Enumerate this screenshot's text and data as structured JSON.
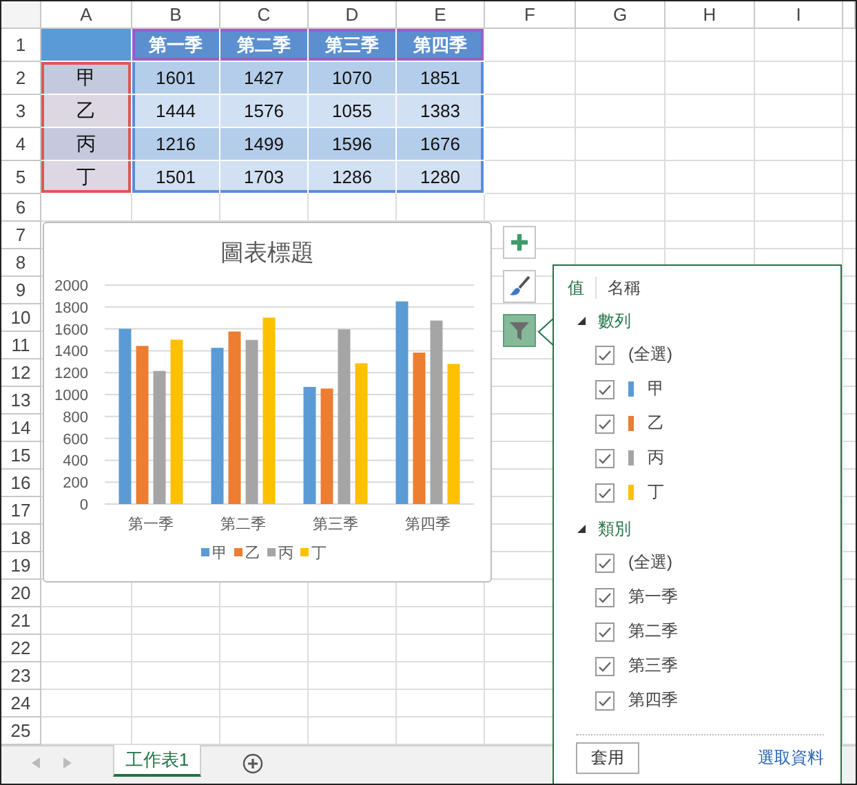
{
  "sheet": {
    "column_headers": [
      "A",
      "B",
      "C",
      "D",
      "E",
      "F",
      "G",
      "H",
      "I"
    ],
    "row_numbers": [
      "1",
      "2",
      "3",
      "4",
      "5",
      "6",
      "7",
      "8",
      "9",
      "10",
      "11",
      "12",
      "13",
      "14",
      "15",
      "16",
      "17",
      "18",
      "19",
      "20",
      "21",
      "22",
      "23",
      "24",
      "25"
    ],
    "table": {
      "header": [
        "第一季",
        "第二季",
        "第三季",
        "第四季"
      ],
      "rows": [
        {
          "label": "甲",
          "values": [
            "1601",
            "1427",
            "1070",
            "1851"
          ]
        },
        {
          "label": "乙",
          "values": [
            "1444",
            "1576",
            "1055",
            "1383"
          ]
        },
        {
          "label": "丙",
          "values": [
            "1216",
            "1499",
            "1596",
            "1676"
          ]
        },
        {
          "label": "丁",
          "values": [
            "1501",
            "1703",
            "1286",
            "1280"
          ]
        }
      ]
    }
  },
  "chart": {
    "chart_data": {
      "type": "bar",
      "title": "圖表標題",
      "categories": [
        "第一季",
        "第二季",
        "第三季",
        "第四季"
      ],
      "series": [
        {
          "name": "甲",
          "color": "#5b9bd5",
          "values": [
            1601,
            1427,
            1070,
            1851
          ]
        },
        {
          "name": "乙",
          "color": "#ed7d31",
          "values": [
            1444,
            1576,
            1055,
            1383
          ]
        },
        {
          "name": "丙",
          "color": "#a5a5a5",
          "values": [
            1216,
            1499,
            1596,
            1676
          ]
        },
        {
          "name": "丁",
          "color": "#ffc000",
          "values": [
            1501,
            1703,
            1286,
            1280
          ]
        }
      ],
      "grid": true,
      "legend": "bottom",
      "ylim": [
        0,
        2000
      ],
      "yticks": [
        0,
        200,
        400,
        600,
        800,
        1000,
        1200,
        1400,
        1600,
        1800,
        2000
      ]
    }
  },
  "chart_buttons": [
    {
      "kind": "add",
      "selected": false
    },
    {
      "kind": "style",
      "selected": false
    },
    {
      "kind": "filter",
      "selected": true
    }
  ],
  "filter_panel": {
    "tabs": [
      {
        "label": "值",
        "selected": true
      },
      {
        "label": "名稱",
        "selected": false
      }
    ],
    "sections": [
      {
        "label": "數列",
        "expanded": true,
        "items": [
          {
            "label": "(全選)",
            "checked": true
          },
          {
            "label": "甲",
            "checked": true,
            "color": "#5b9bd5"
          },
          {
            "label": "乙",
            "checked": true,
            "color": "#ed7d31"
          },
          {
            "label": "丙",
            "checked": true,
            "color": "#a5a5a5"
          },
          {
            "label": "丁",
            "checked": true,
            "color": "#ffc000"
          }
        ]
      },
      {
        "label": "類別",
        "expanded": true,
        "items": [
          {
            "label": "(全選)",
            "checked": true
          },
          {
            "label": "第一季",
            "checked": true
          },
          {
            "label": "第二季",
            "checked": true
          },
          {
            "label": "第三季",
            "checked": true
          },
          {
            "label": "第四季",
            "checked": true
          }
        ]
      }
    ],
    "apply_button": "套用",
    "select_data_link": "選取資料"
  },
  "sheet_tabs": [
    {
      "label": "工作表1",
      "selected": true
    }
  ]
}
